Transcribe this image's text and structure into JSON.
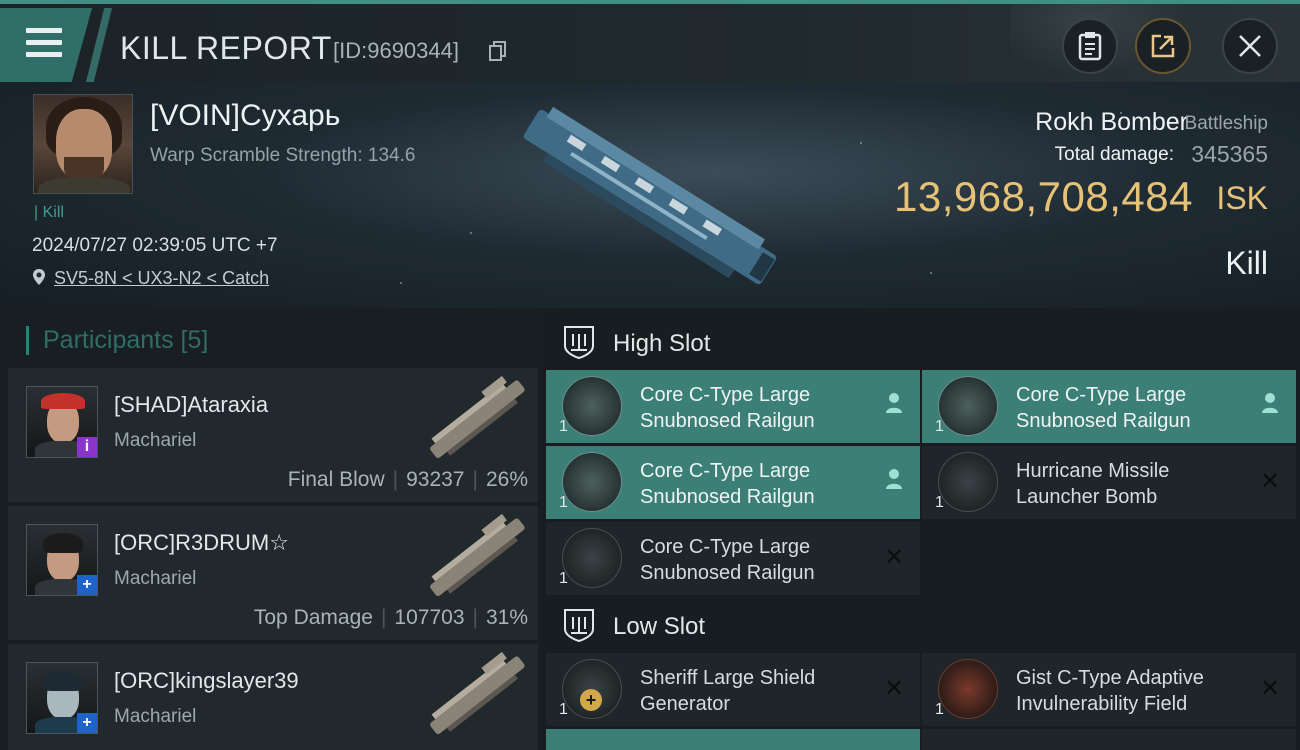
{
  "header": {
    "title": "KILL REPORT",
    "report_id": "[ID:9690344]",
    "icons": [
      "menu-icon",
      "clipboard-icon",
      "share-icon",
      "close-icon",
      "copy-icon"
    ]
  },
  "victim": {
    "name": "[VOIN]Сухарь",
    "warp_scramble": "Warp Scramble Strength: 134.6",
    "kill_tag": "| Kill",
    "datetime": "2024/07/27 02:39:05 UTC +7",
    "location": "SV5-8N < UX3-N2 < Catch",
    "ship_name": "Rokh Bomber",
    "ship_class": "Battleship",
    "total_damage_label": "Total damage:",
    "total_damage": "345365",
    "isk_value": "13,968,708,484",
    "isk_unit": "ISK",
    "result": "Kill"
  },
  "participants": {
    "header": "Participants [5]",
    "items": [
      {
        "name": "[SHAD]Ataraxia",
        "ship": "Machariel",
        "role": "Final Blow",
        "damage": "93237",
        "percent": "26%",
        "badge": "i"
      },
      {
        "name": "[ORC]R3DRUM☆",
        "ship": "Machariel",
        "role": "Top Damage",
        "damage": "107703",
        "percent": "31%",
        "badge": "+"
      },
      {
        "name": "[ORC]kingslayer39",
        "ship": "Machariel",
        "role": "",
        "damage": "",
        "percent": "",
        "badge": "+"
      }
    ]
  },
  "fitting": {
    "high_slot_title": "High Slot",
    "low_slot_title": "Low Slot",
    "high_slot": [
      {
        "name": "Core C-Type Large Snubnosed Railgun",
        "qty": "1",
        "status": "dropped"
      },
      {
        "name": "Core C-Type Large Snubnosed Railgun",
        "qty": "1",
        "status": "dropped"
      },
      {
        "name": "Core C-Type Large Snubnosed Railgun",
        "qty": "1",
        "status": "dropped"
      },
      {
        "name": "Hurricane Missile Launcher Bomb",
        "qty": "1",
        "status": "destroyed"
      },
      {
        "name": "Core C-Type Large Snubnosed Railgun",
        "qty": "1",
        "status": "destroyed"
      }
    ],
    "low_slot": [
      {
        "name": "Sheriff Large Shield Generator",
        "qty": "1",
        "status": "destroyed"
      },
      {
        "name": "Gist C-Type Adaptive Invulnerability Field",
        "qty": "1",
        "status": "destroyed"
      }
    ]
  },
  "colors": {
    "accent": "#3b7f77",
    "isk": "#e6c277",
    "badge_purple": "#8a34c8",
    "badge_blue": "#1f63c9"
  }
}
